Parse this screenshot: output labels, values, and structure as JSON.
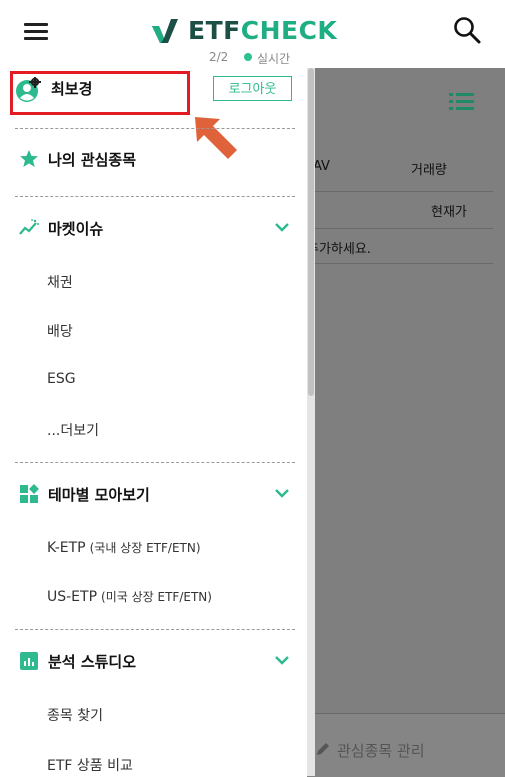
{
  "header": {
    "logo_etf": "ETF",
    "logo_check": "CHECK",
    "page_indicator": "2/2",
    "live_label": "실시간"
  },
  "drawer": {
    "user_name": "최보경",
    "login_button": "로그아웃",
    "favorites_label": "나의 관심종목",
    "market_issues": {
      "label": "마켓이슈",
      "items": [
        "채권",
        "배당",
        "ESG",
        "...더보기"
      ]
    },
    "themes": {
      "label": "테마별 모아보기",
      "items": [
        {
          "label": "K-ETP",
          "note": "(국내 상장 ETF/ETN)"
        },
        {
          "label": "US-ETP",
          "note": "(미국 상장 ETF/ETN)"
        }
      ]
    },
    "analysis": {
      "label": "분석 스튜디오",
      "items": [
        "종목 찾기",
        "ETF 상품 비교"
      ]
    }
  },
  "background": {
    "col_nav": "AV",
    "col_volume": "거래량",
    "col_price": "현재가",
    "empty_message": "추가하세요.",
    "bottom_button": "관심종목 관리"
  },
  "colors": {
    "accent": "#2eb98e",
    "brand_dark": "#1c4f46",
    "highlight": "#e31b23",
    "arrow": "#e0623a"
  },
  "icons": [
    "menu-icon",
    "logo-icon",
    "search-icon",
    "user-settings-icon",
    "star-icon",
    "trend-icon",
    "dashboard-icon",
    "chart-icon",
    "chevron-down-icon",
    "list-icon",
    "pencil-icon",
    "arrow-pointer-icon"
  ]
}
